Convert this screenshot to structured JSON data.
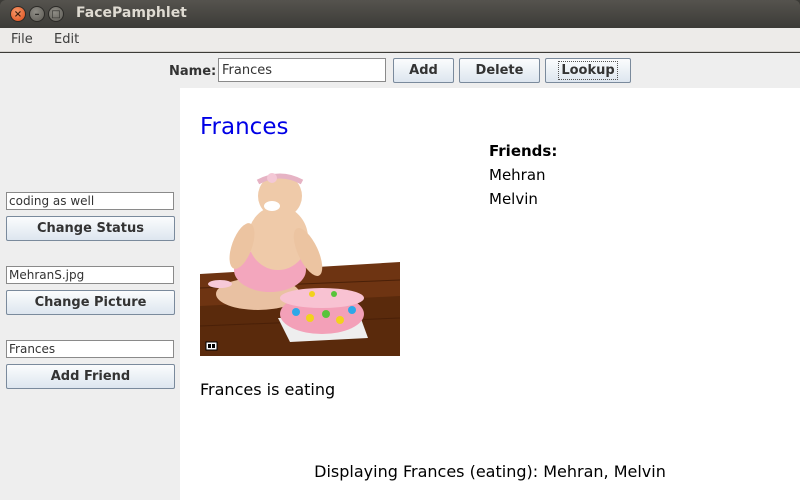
{
  "window": {
    "title": "FacePamphlet"
  },
  "menu": {
    "file": "File",
    "edit": "Edit"
  },
  "toolbar": {
    "name_label": "Name:",
    "name_value": "Frances",
    "add_label": "Add",
    "delete_label": "Delete",
    "lookup_label": "Lookup"
  },
  "sidebar": {
    "status_value": "coding as well",
    "change_status_label": "Change Status",
    "picture_value": "MehranS.jpg",
    "change_picture_label": "Change Picture",
    "friend_value": "Frances",
    "add_friend_label": "Add Friend"
  },
  "profile": {
    "name": "Frances",
    "friends_heading": "Friends:",
    "friends": [
      "Mehran",
      "Melvin"
    ],
    "status": "Frances is eating"
  },
  "display_message": "Displaying Frances (eating): Mehran, Melvin",
  "colors": {
    "profile_name": "#0000e6",
    "close_button": "#df4a16",
    "titlebar": "#3c3b37"
  },
  "icons": [
    "close-icon",
    "minimize-icon",
    "maximize-icon"
  ]
}
